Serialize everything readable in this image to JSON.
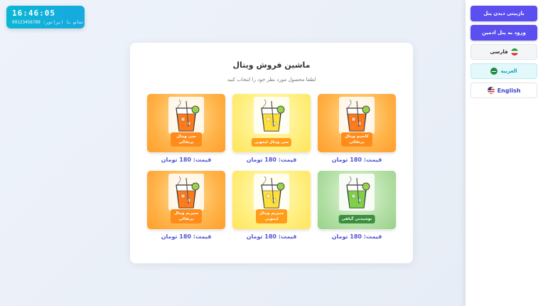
{
  "clock": {
    "time": "16:46:05",
    "phone": "تماس با اپراتور: 09123456789"
  },
  "panel": {
    "update_button": "بازبینی دیدن پنل",
    "admin_button": "ورود به پنل ادمین",
    "languages": [
      {
        "label": "فارسی",
        "flag": "iran-flag-icon",
        "active": false
      },
      {
        "label": "العربية",
        "flag": "saudi-flag-icon",
        "active": true
      },
      {
        "label": "English",
        "flag": "us-flag-icon",
        "active": false
      }
    ]
  },
  "main": {
    "title": "ماشین فروش ویتال",
    "subtitle": "لطفا محصول مورد نظر خود را انتخاب کنید",
    "products": [
      {
        "name": "کاسیم ویتال پرتقالی",
        "price": "قیمت: 180 تومان",
        "color": "orange",
        "liquid": "#ff7a1a"
      },
      {
        "name": "سی ویتال لیمویی",
        "price": "قیمت: 180 تومان",
        "color": "yellow",
        "liquid": "#ffe03a"
      },
      {
        "name": "سی ویتال پرتقالی",
        "price": "قیمت: 180 تومان",
        "color": "orange",
        "liquid": "#ff7a1a"
      },
      {
        "name": "نوشیدنی گیاهی",
        "price": "قیمت: 180 تومان",
        "color": "green",
        "liquid": "#7fd04a"
      },
      {
        "name": "منیزیم ویتال لیمویی",
        "price": "قیمت: 180 تومان",
        "color": "yellow",
        "liquid": "#ffe03a"
      },
      {
        "name": "منیزیم ویتال پرتقالی",
        "price": "قیمت: 180 تومان",
        "color": "orange",
        "liquid": "#ff7a1a"
      }
    ]
  }
}
